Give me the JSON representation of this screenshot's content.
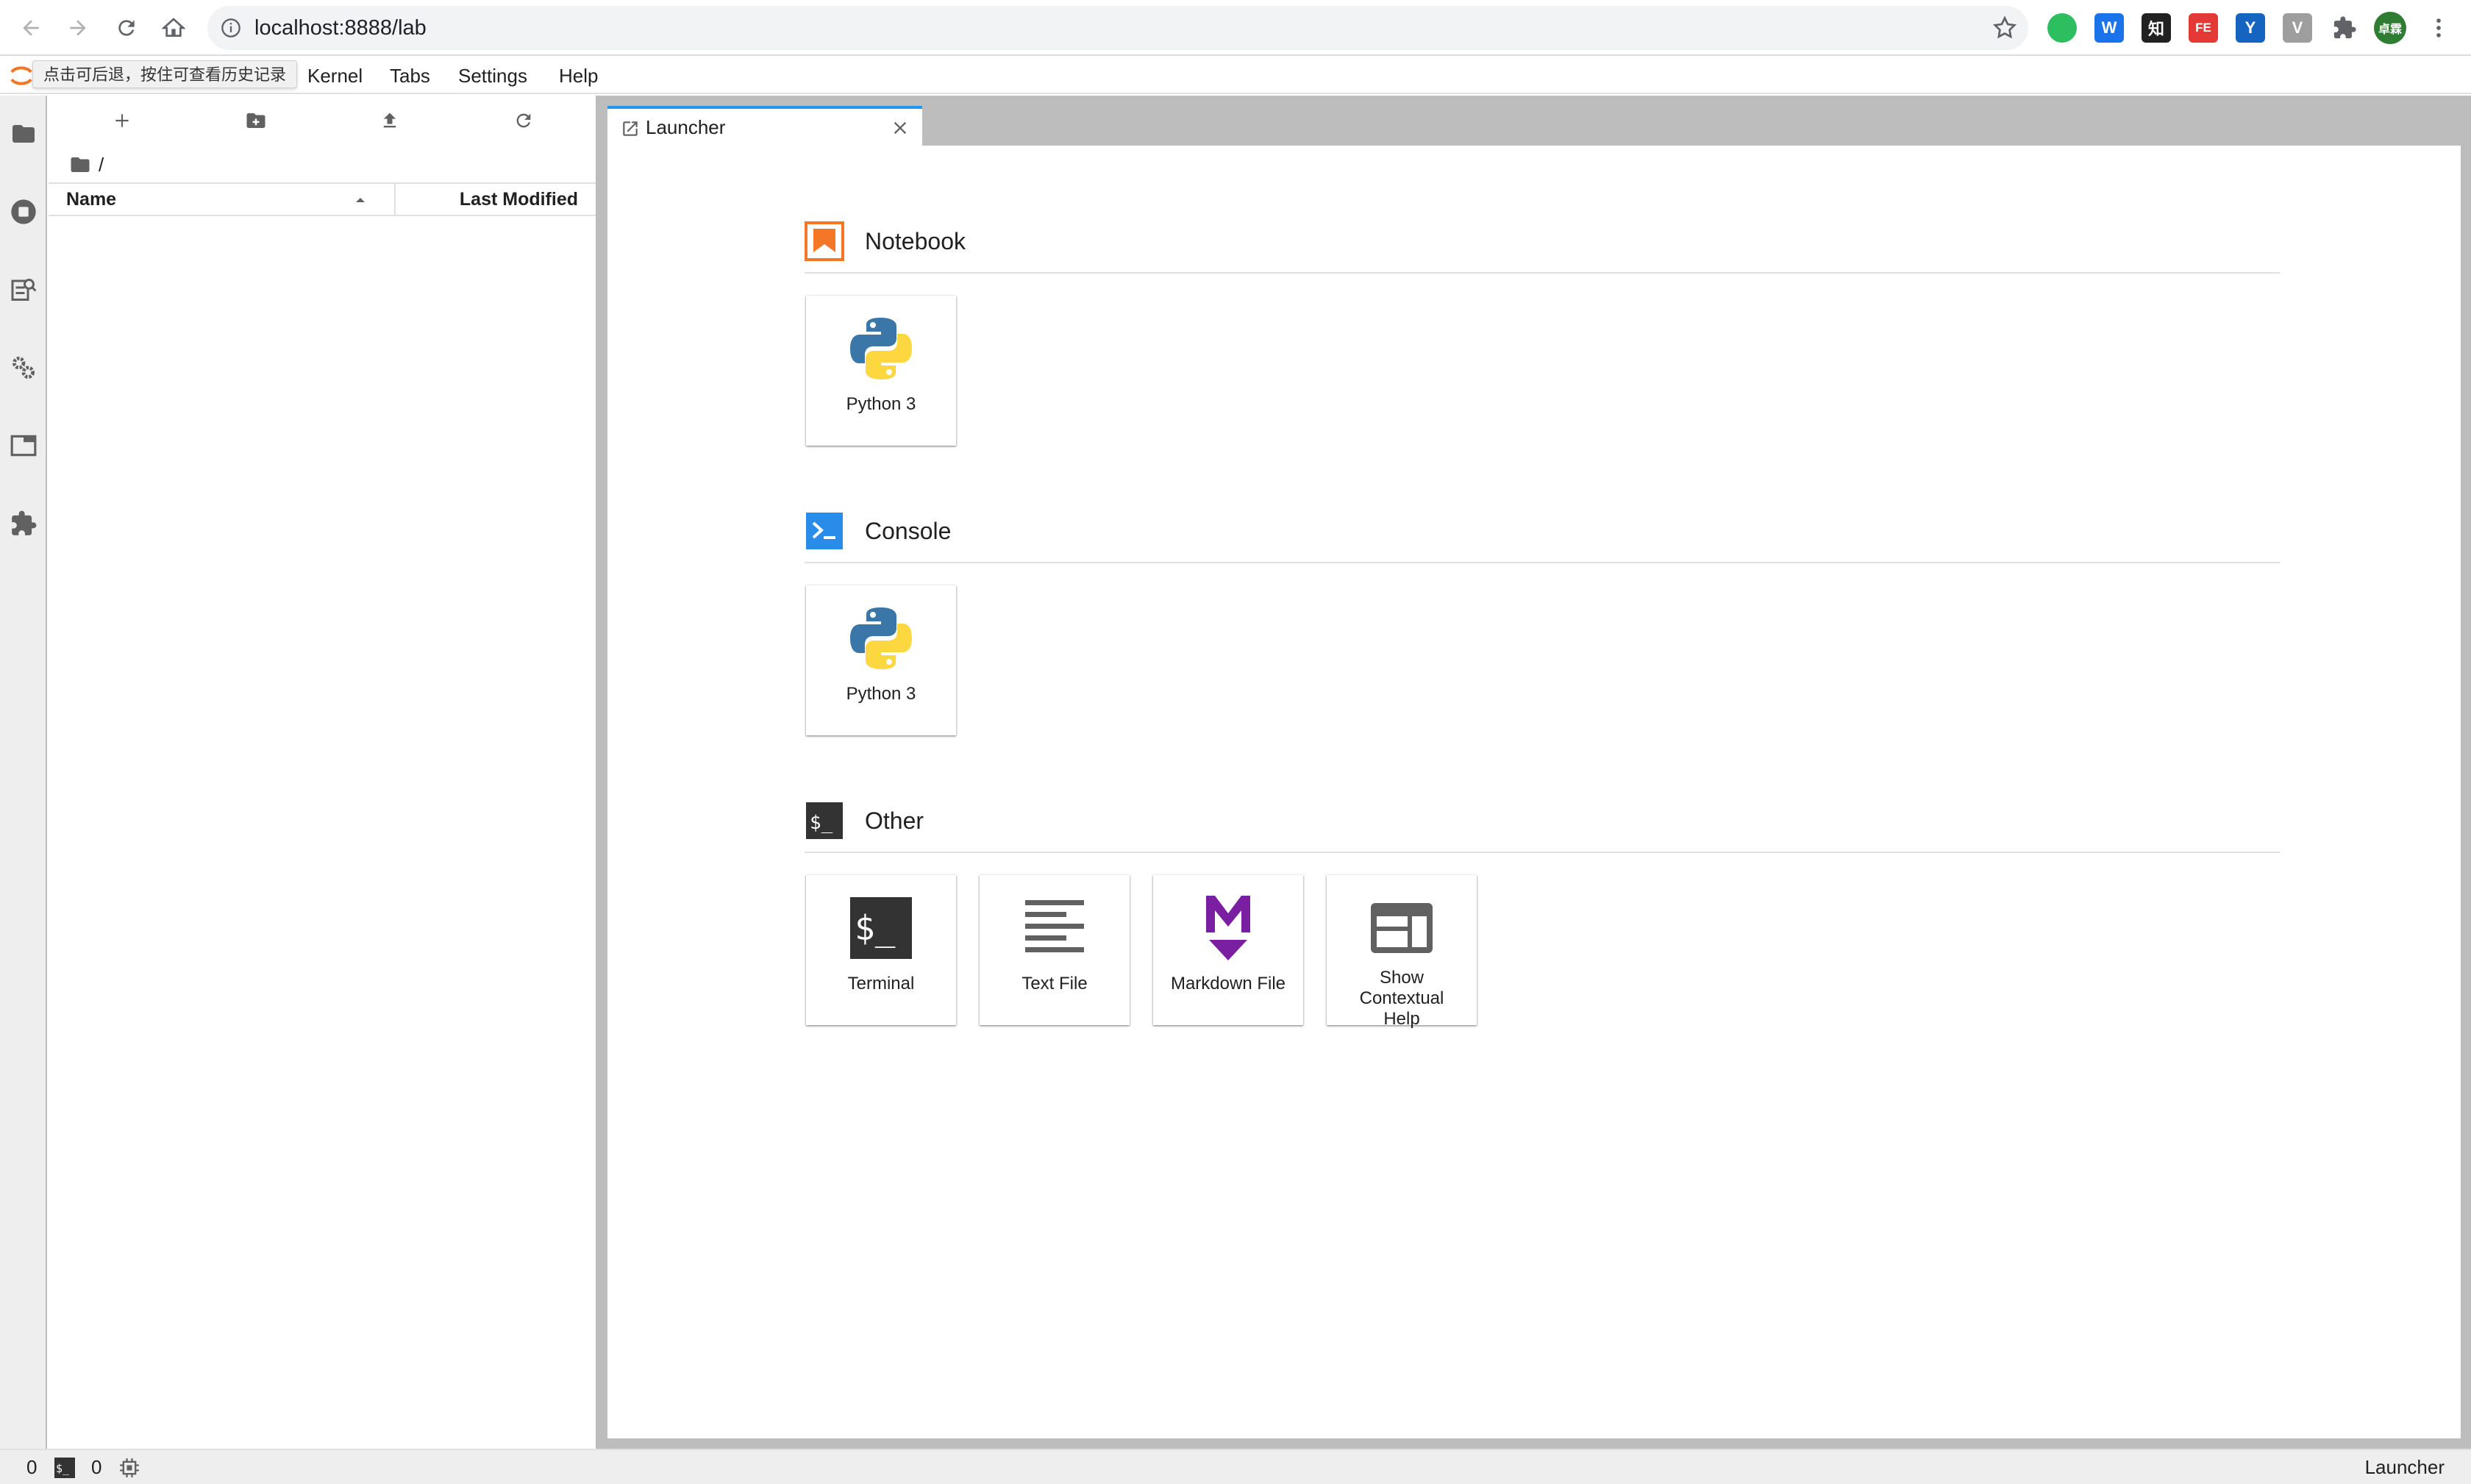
{
  "browser": {
    "url": "localhost:8888/lab",
    "profile_initials": "卓霖",
    "extensions": [
      {
        "name": "evernote-icon",
        "color": "#2dbe60",
        "glyph": ""
      },
      {
        "name": "word-icon",
        "color": "#1a73e8",
        "glyph": "W"
      },
      {
        "name": "zhihu-icon",
        "color": "#222222",
        "glyph": "知"
      },
      {
        "name": "fe-icon",
        "color": "#e53935",
        "glyph": "FE"
      },
      {
        "name": "y-icon",
        "color": "#1565c0",
        "glyph": "Y"
      },
      {
        "name": "vue-icon",
        "color": "#9e9e9e",
        "glyph": "V"
      }
    ]
  },
  "menubar": {
    "tooltip": "点击可后退，按住可查看历史记录",
    "items": [
      "Kernel",
      "Tabs",
      "Settings",
      "Help"
    ]
  },
  "file_browser": {
    "breadcrumb": "/",
    "columns": {
      "name": "Name",
      "modified": "Last Modified"
    }
  },
  "tabs": [
    {
      "label": "Launcher"
    }
  ],
  "launcher": {
    "sections": [
      {
        "title": "Notebook",
        "cards": [
          {
            "label": "Python 3",
            "icon": "python-icon"
          }
        ]
      },
      {
        "title": "Console",
        "cards": [
          {
            "label": "Python 3",
            "icon": "python-icon"
          }
        ]
      },
      {
        "title": "Other",
        "cards": [
          {
            "label": "Terminal",
            "icon": "terminal-icon"
          },
          {
            "label": "Text File",
            "icon": "text-file-icon"
          },
          {
            "label": "Markdown File",
            "icon": "markdown-icon"
          },
          {
            "label": "Show Contextual Help",
            "icon": "contextual-help-icon"
          }
        ]
      }
    ]
  },
  "statusbar": {
    "terminals_count": "0",
    "kernels_count": "0",
    "right_label": "Launcher"
  },
  "colors": {
    "accent": "#2196f3",
    "notebook_orange": "#f37726",
    "console_blue": "#288ce8",
    "markdown_purple": "#7b1fa2"
  }
}
